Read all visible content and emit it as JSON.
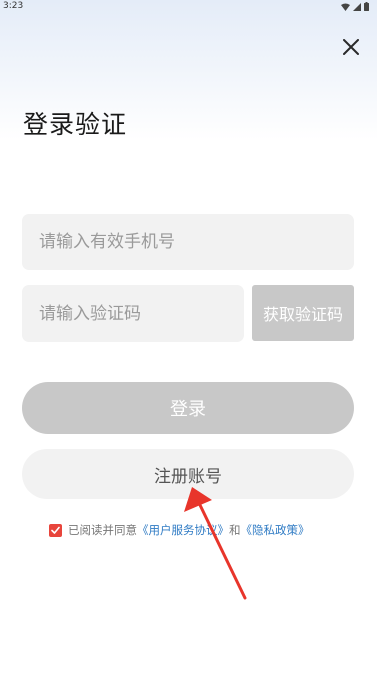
{
  "status_bar": {
    "time": "3:23",
    "icons": [
      "wifi-icon",
      "signal-icon",
      "battery-icon"
    ]
  },
  "header": {
    "close_icon": "close-icon"
  },
  "title": "登录验证",
  "form": {
    "phone_placeholder": "请输入有效手机号",
    "code_placeholder": "请输入验证码",
    "get_code_label": "获取验证码",
    "login_label": "登录",
    "register_label": "注册账号"
  },
  "agreement": {
    "checked": true,
    "prefix": "已阅读并同意",
    "user_agreement": "《用户服务协议》",
    "conjunction": "和",
    "privacy_policy": "《隐私政策》"
  },
  "colors": {
    "accent_red": "#e8453c",
    "link_blue": "#2f7bc4",
    "disabled_gray": "#c8c8c8",
    "field_bg": "#f2f2f2"
  },
  "annotation": {
    "type": "red-arrow",
    "points_to": "register-button"
  }
}
